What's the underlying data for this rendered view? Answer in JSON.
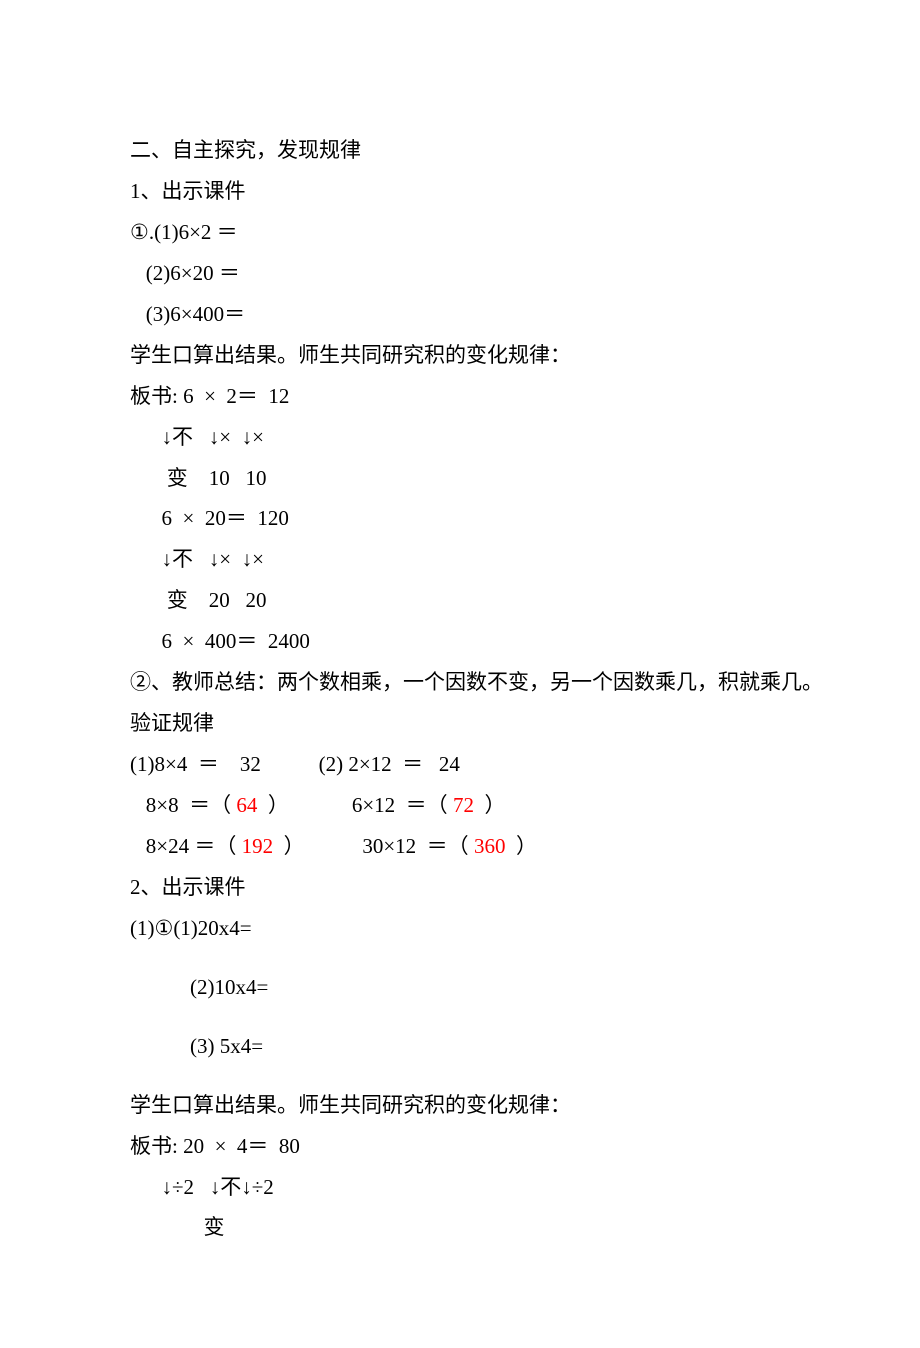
{
  "h1": "二、自主探究，发现规律",
  "p1": "1、出示课件",
  "q1a": "①.(1)6×2 ＝",
  "q1b": "   (2)6×20 ＝",
  "q1c": "   (3)6×400＝",
  "obs1": "学生口算出结果。师生共同研究积的变化规律：",
  "b1": "板书: 6  ×  2＝  12",
  "b2": "      ↓不   ↓×  ↓×",
  "b3": "       变    10   10",
  "b4": "      6  ×  20＝  120",
  "b5": "      ↓不   ↓×  ↓×",
  "b6": "       变    20   20",
  "b7": "      6  ×  400＝  2400",
  "sum1": "②、教师总结：两个数相乘，一个因数不变，另一个因数乘几，积就乘几。",
  "ver": "验证规律",
  "v1a": "(1)8×4  ＝    32           (2) 2×12  ＝   24",
  "v2a_p1": "   8×8  ＝（ ",
  "v2a_a1": "64",
  "v2a_p2": "  ）            6×12  ＝（ ",
  "v2a_a2": "72",
  "v2a_p3": "  ）",
  "v3a_p1": "   8×24 ＝（ ",
  "v3a_a1": "192",
  "v3a_p2": "  ）           30×12  ＝（ ",
  "v3a_a2": "360",
  "v3a_p3": "  ）",
  "p2": "2、出示课件",
  "q2a": "(1)①(1)20x4=",
  "q2b": "(2)10x4=",
  "q2c": "(3) 5x4=",
  "obs2": "学生口算出结果。师生共同研究积的变化规律：",
  "b8": "板书: 20  ×  4＝  80",
  "b9": "      ↓÷2   ↓不↓÷2",
  "b10": "              变"
}
